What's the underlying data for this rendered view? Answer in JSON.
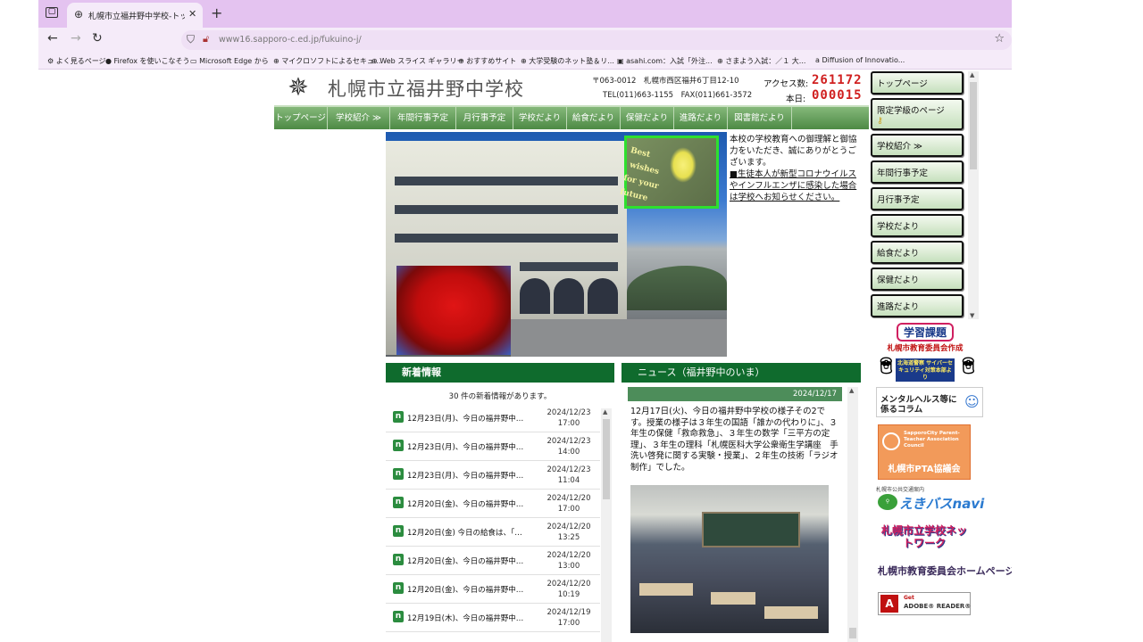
{
  "browser": {
    "tab_title": "札幌市立福井野中学校-トップペ",
    "url": "www16.sapporo-c.ed.jp/fukuino-j/",
    "bookmarks": [
      "よく見るページ",
      "Firefox を使いこなそう",
      "Microsoft Edge から",
      "マイクロソフトによるセキュ...",
      "Web スライス ギャラリー",
      "おすすめサイト",
      "大学受験のネット塾＆リ...",
      "asahi.com：入試「外注...",
      "さまよう入試：／１ 大...",
      "Diffusion of Innovatio..."
    ]
  },
  "header": {
    "school_name": "札幌市立福井野中学校",
    "address_line1": "〒063-0012　札幌市西区福井6丁目12-10",
    "address_line2": "TEL(011)663-1155　FAX(011)661-3572",
    "access_label": "アクセス数:",
    "access_count": "261172",
    "today_label": "本日:",
    "today_count": "000015"
  },
  "global_nav": [
    "トップページ",
    "学校紹介 ≫",
    "年間行事予定",
    "月行事予定",
    "学校だより",
    "給食だより",
    "保健だより",
    "進路だより",
    "図書館だより"
  ],
  "side_nav": [
    "トップページ",
    "限定学級のページ",
    "学校紹介 ≫",
    "年間行事予定",
    "月行事予定",
    "学校だより",
    "給食だより",
    "保健だより",
    "進路だより"
  ],
  "hero": {
    "ribbon_text": "Best\n wishes\nfor your\nfuture"
  },
  "intro": {
    "lead": "本校の学校教育への御理解と御協力をいただき、誠にありがとうございます。",
    "link": "■生徒本人が新型コロナウイルスやインフルエンザに感染した場合は学校へお知らせください。"
  },
  "news": {
    "heading": "新着情報",
    "count_text": "30 件の新着情報があります。",
    "items": [
      {
        "text": "12月23日(月)、今日の福井野中…",
        "date": "2024/12/23",
        "time": "17:00"
      },
      {
        "text": "12月23日(月)、今日の福井野中…",
        "date": "2024/12/23",
        "time": "14:00"
      },
      {
        "text": "12月23日(月)、今日の福井野中…",
        "date": "2024/12/23",
        "time": "11:04"
      },
      {
        "text": "12月20日(金)、今日の福井野中…",
        "date": "2024/12/20",
        "time": "17:00"
      },
      {
        "text": "12月20日(金) 今日の給食は、「…",
        "date": "2024/12/20",
        "time": "13:25"
      },
      {
        "text": "12月20日(金)、今日の福井野中…",
        "date": "2024/12/20",
        "time": "13:00"
      },
      {
        "text": "12月20日(金)、今日の福井野中…",
        "date": "2024/12/20",
        "time": "10:19"
      },
      {
        "text": "12月19日(木)、今日の福井野中…",
        "date": "2024/12/19",
        "time": "17:00"
      }
    ]
  },
  "post": {
    "heading": "ニュース（福井野中のいま）",
    "date": "2024/12/17",
    "body": "12月17日(火)、今日の福井野中学校の様子その2です。授業の様子は３年生の国語「誰かの代わりに」、３年生の保健「救命救急」、３年生の数学「三平方の定理」、３年生の理科「札幌医科大学公衆衛生学講座　手洗い啓発に関する実験・授業」、２年生の技術「ラジオ制作」でした。"
  },
  "banners": {
    "gakushu": "学習課題",
    "gakushu_sub": "札幌市教育委員会作成",
    "cyber": "北海道警察 サイバーセキュリティ対策本部より",
    "mental": "メンタルヘルス等に係るコラム",
    "pta_en": "SapporoCity Parent-Teacher Association Council",
    "pta": "札幌市PTA協議会",
    "ekibus_small": "札幌市公共交通案内",
    "ekibus": "えきバスnavi",
    "network": "札幌市立学校ネットワーク",
    "board": "札幌市教育委員会ホームページ",
    "adobe_small": "Get",
    "adobe": "ADOBE® READER®"
  },
  "colors": {
    "nav_green": "#4d8a45",
    "section_green": "#0f6b2d",
    "counter_red": "#d02020",
    "chrome_purple": "#e4c3f0"
  }
}
